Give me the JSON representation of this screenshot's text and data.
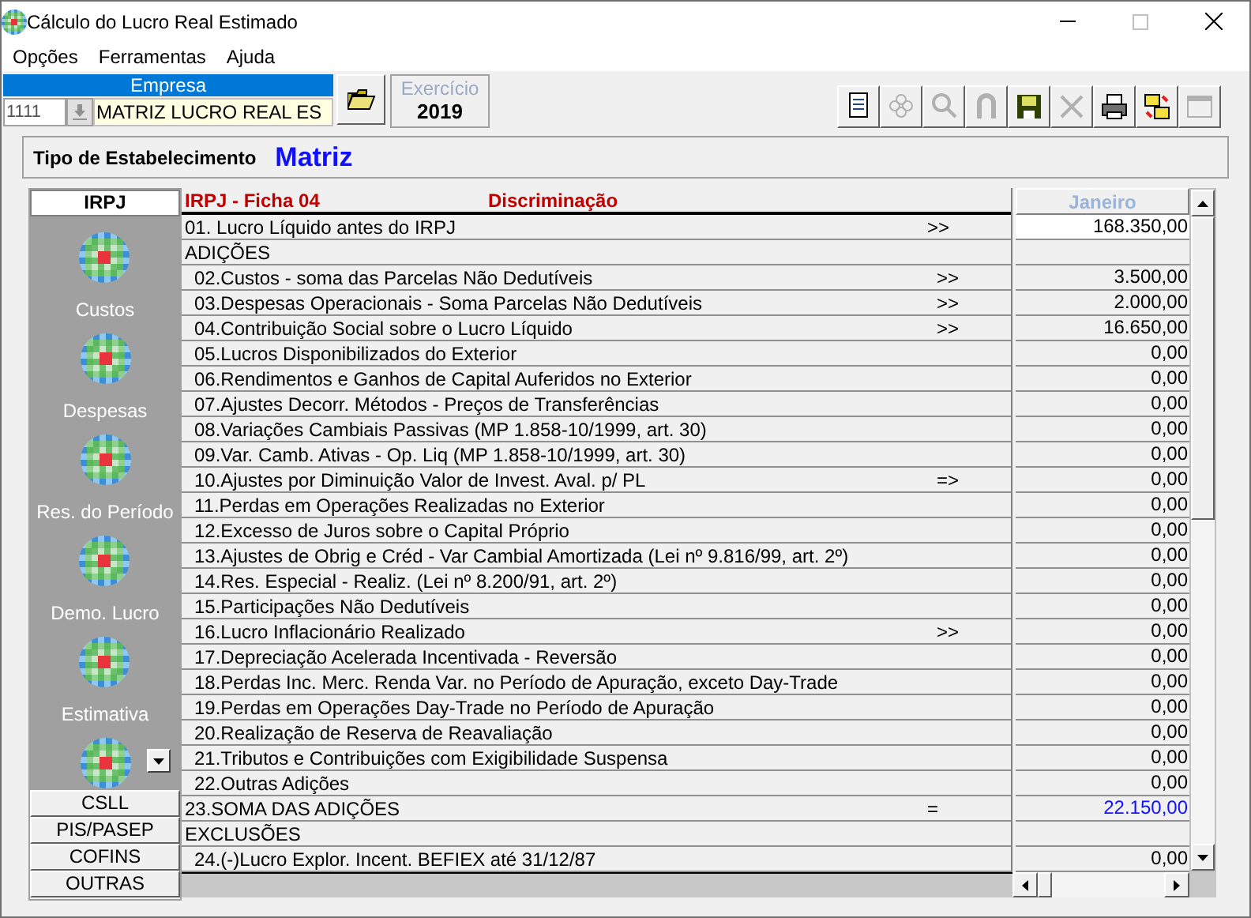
{
  "window": {
    "title": "Cálculo do Lucro Real Estimado"
  },
  "menu": [
    "Opções",
    "Ferramentas",
    "Ajuda"
  ],
  "empresa": {
    "label": "Empresa",
    "code": "1111",
    "name": "MATRIZ LUCRO REAL ES"
  },
  "exercicio": {
    "label": "Exercício",
    "value": "2019"
  },
  "toolbar": [
    {
      "kind": "document",
      "disabled": false
    },
    {
      "kind": "flower",
      "disabled": true
    },
    {
      "kind": "search",
      "disabled": true
    },
    {
      "kind": "magnet",
      "disabled": true
    },
    {
      "kind": "save",
      "disabled": false
    },
    {
      "kind": "delete",
      "disabled": true
    },
    {
      "kind": "print",
      "disabled": false
    },
    {
      "kind": "folders",
      "disabled": false
    },
    {
      "kind": "window",
      "disabled": true
    }
  ],
  "tipo": {
    "label": "Tipo de Estabelecimento",
    "value": "Matriz"
  },
  "tabs_top": [
    {
      "label": "IRPJ",
      "selected": true
    }
  ],
  "sidebar": {
    "items": [
      {
        "kind": "labeled",
        "label": "Custos"
      },
      {
        "kind": "labeled",
        "label": "Despesas"
      },
      {
        "kind": "labeled",
        "label": "Res. do Período"
      },
      {
        "kind": "labeled",
        "label": "Demo. Lucro"
      },
      {
        "kind": "labeled",
        "label": "Estimativa"
      },
      {
        "kind": "partial"
      }
    ]
  },
  "tabs_bottom": [
    {
      "label": "CSLL",
      "selected": false
    },
    {
      "label": "PIS/PASEP",
      "selected": false
    },
    {
      "label": "COFINS",
      "selected": false
    },
    {
      "label": "OUTRAS",
      "selected": false
    }
  ],
  "table": {
    "ficha": "IRPJ - Ficha 04",
    "column_title": "Discriminação",
    "month": "Janeiro",
    "rows": [
      {
        "kind": "top",
        "label": "01. Lucro Líquido antes do IRPJ",
        "marker": ">>",
        "value": "168.350,00",
        "selected": true
      },
      {
        "kind": "section",
        "label": "ADIÇÕES"
      },
      {
        "kind": "item",
        "label": "02.Custos - soma das Parcelas Não Dedutíveis",
        "marker": ">>",
        "value": "3.500,00",
        "selected": false
      },
      {
        "kind": "item",
        "label": "03.Despesas Operacionais - Soma Parcelas Não Dedutíveis",
        "marker": ">>",
        "value": "2.000,00",
        "selected": false
      },
      {
        "kind": "item",
        "label": "04.Contribuição Social sobre o Lucro Líquido",
        "marker": ">>",
        "value": "16.650,00",
        "selected": false
      },
      {
        "kind": "item",
        "label": "05.Lucros Disponibilizados do Exterior",
        "value": "0,00",
        "selected": false
      },
      {
        "kind": "item",
        "label": "06.Rendimentos e Ganhos de Capital Auferidos no Exterior",
        "value": "0,00",
        "selected": false
      },
      {
        "kind": "item",
        "label": "07.Ajustes Decorr. Métodos - Preços de Transferências",
        "value": "0,00",
        "selected": false
      },
      {
        "kind": "item",
        "label": "08.Variações Cambiais Passivas (MP 1.858-10/1999, art. 30)",
        "value": "0,00",
        "selected": false
      },
      {
        "kind": "item",
        "label": "09.Var. Camb. Ativas - Op. Liq (MP 1.858-10/1999, art. 30)",
        "value": "0,00",
        "selected": false
      },
      {
        "kind": "item",
        "label": "10.Ajustes por Diminuição Valor de Invest. Aval. p/ PL",
        "marker": "=>",
        "value": "0,00",
        "selected": false
      },
      {
        "kind": "item",
        "label": "11.Perdas em Operações Realizadas no Exterior",
        "value": "0,00",
        "selected": false
      },
      {
        "kind": "item",
        "label": "12.Excesso de Juros sobre o Capital Próprio",
        "value": "0,00",
        "selected": false
      },
      {
        "kind": "item",
        "label": "13.Ajustes de Obrig e Créd - Var Cambial Amortizada (Lei nº 9.816/99, art. 2º)",
        "value": "0,00",
        "selected": false
      },
      {
        "kind": "item",
        "label": "14.Res. Especial - Realiz. (Lei nº 8.200/91, art. 2º)",
        "value": "0,00",
        "selected": false
      },
      {
        "kind": "item",
        "label": "15.Participações Não Dedutíveis",
        "value": "0,00",
        "selected": false
      },
      {
        "kind": "item",
        "label": "16.Lucro Inflacionário Realizado",
        "marker": ">>",
        "value": "0,00",
        "selected": false
      },
      {
        "kind": "item",
        "label": "17.Depreciação Acelerada Incentivada - Reversão",
        "value": "0,00",
        "selected": false
      },
      {
        "kind": "item",
        "label": "18.Perdas Inc. Merc. Renda Var. no Período de Apuração, exceto Day-Trade",
        "value": "0,00",
        "selected": false
      },
      {
        "kind": "item",
        "label": "19.Perdas em Operações Day-Trade no Período de Apuração",
        "value": "0,00",
        "selected": false
      },
      {
        "kind": "item",
        "label": "20.Realização de Reserva de Reavaliação",
        "value": "0,00",
        "selected": false
      },
      {
        "kind": "item",
        "label": "21.Tributos e Contribuições com Exigibilidade Suspensa",
        "value": "0,00",
        "selected": false
      },
      {
        "kind": "item",
        "label": "22.Outras Adições",
        "value": "0,00",
        "selected": false
      },
      {
        "kind": "total",
        "label": "23.SOMA DAS ADIÇÕES",
        "marker": "=",
        "value": "22.150,00",
        "selected": false
      },
      {
        "kind": "section",
        "label": "EXCLUSÕES"
      },
      {
        "kind": "item",
        "label": "24.(-)Lucro Explor. Incent. BEFIEX até 31/12/87",
        "value": "0,00",
        "selected": false
      }
    ]
  }
}
